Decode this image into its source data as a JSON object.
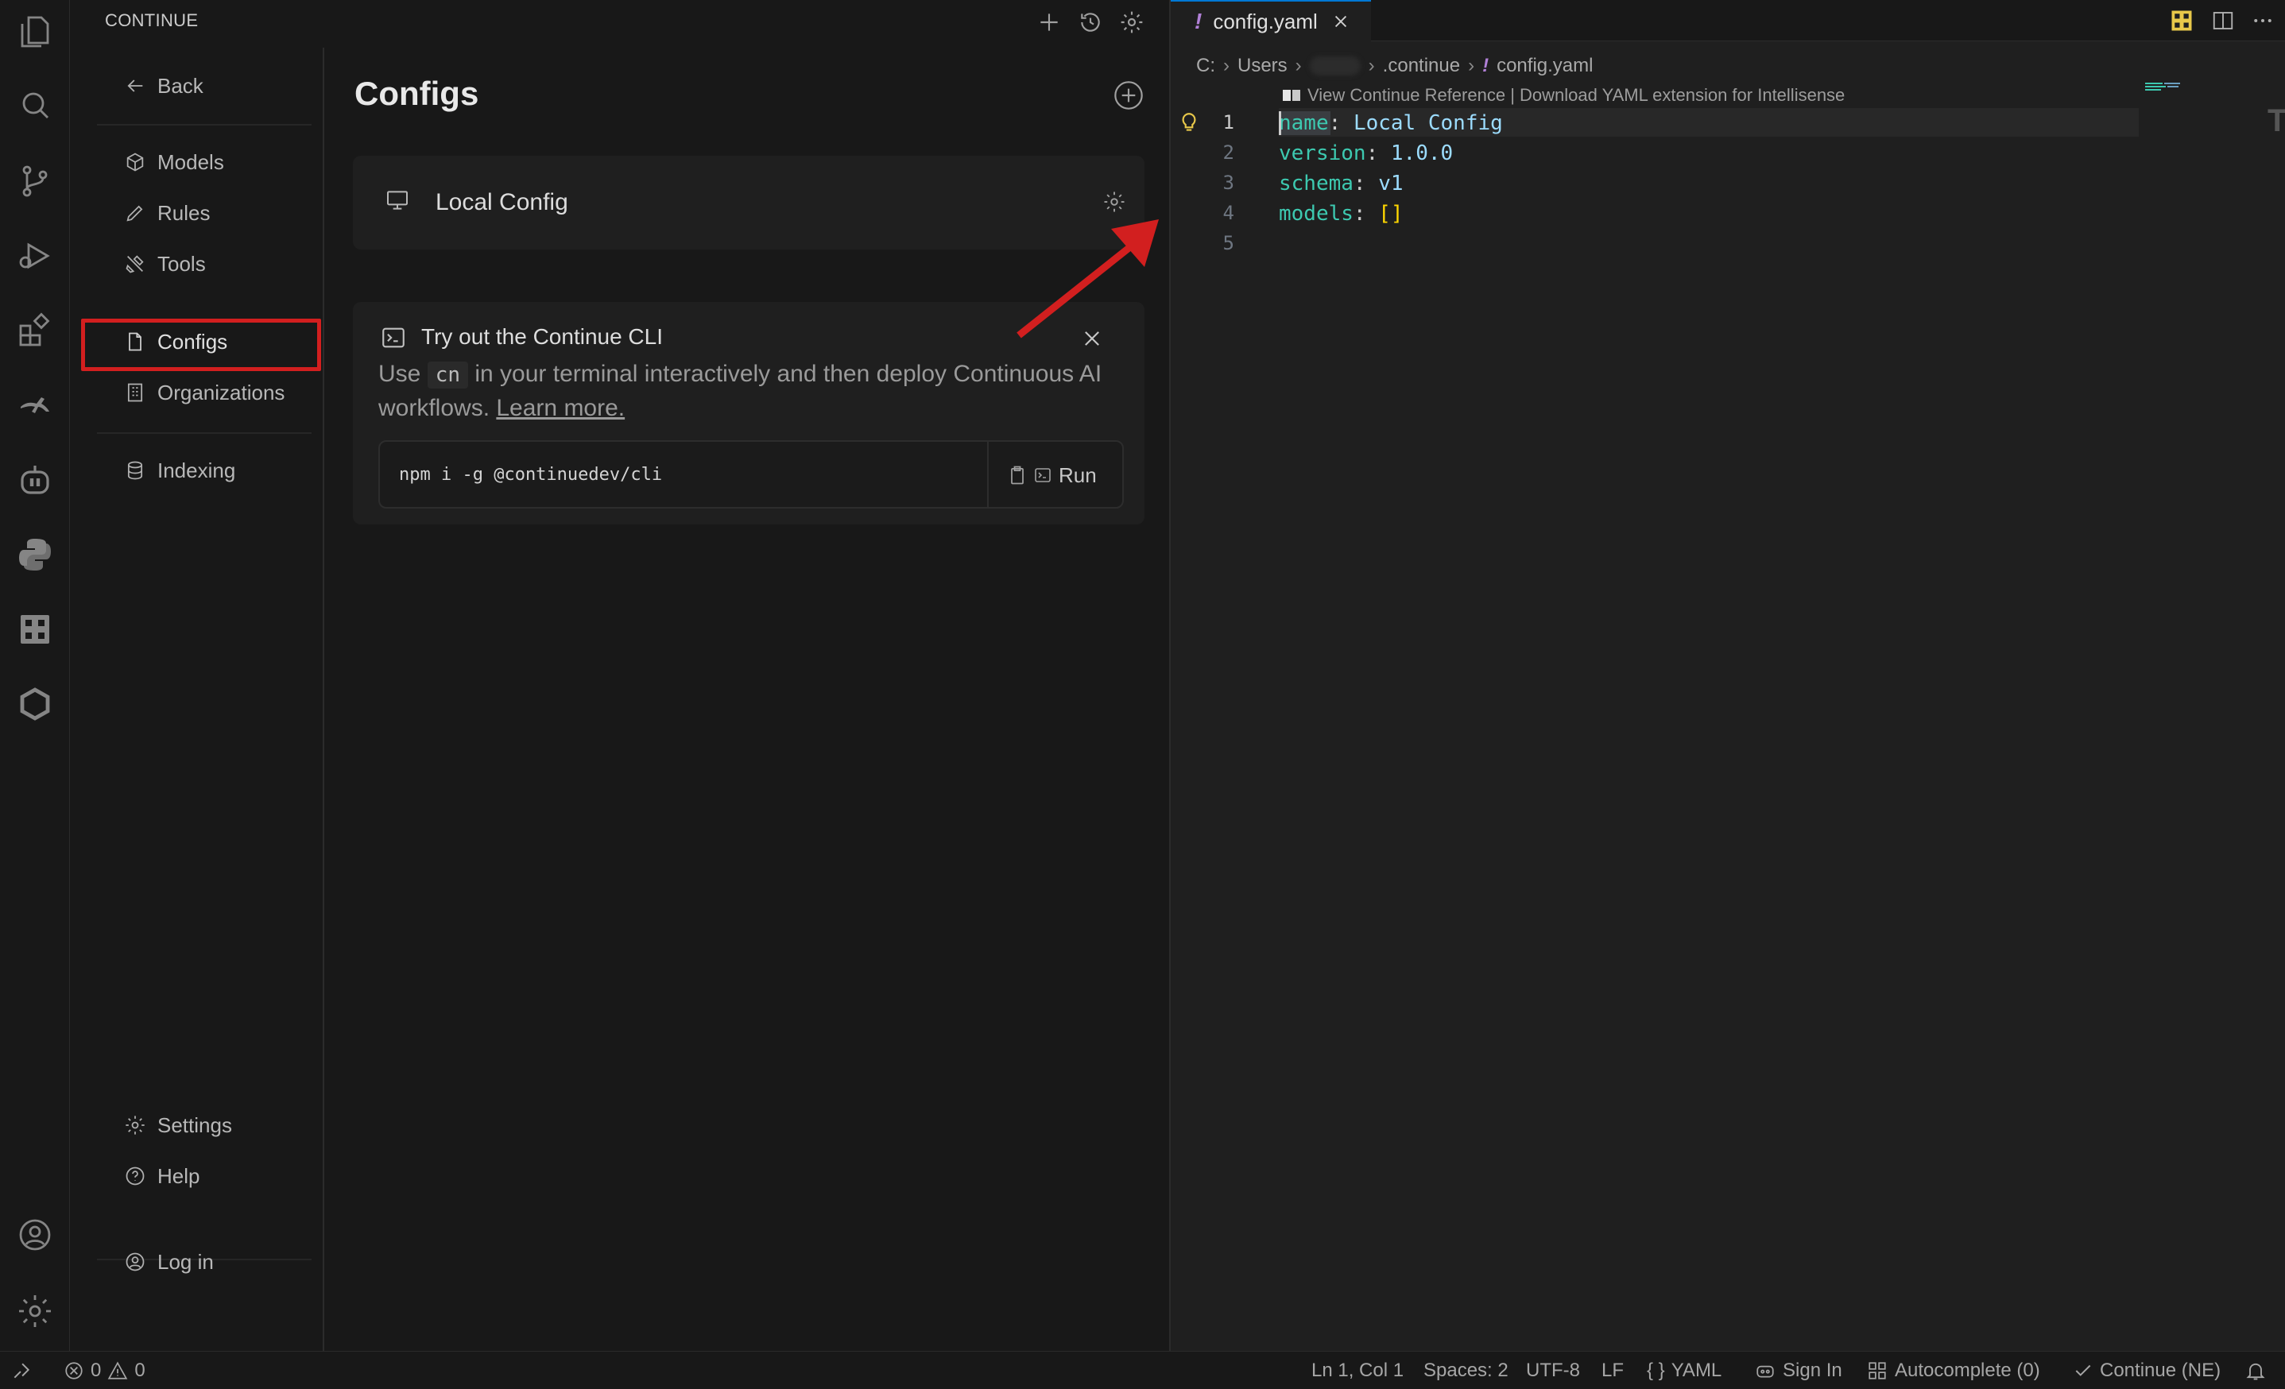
{
  "sidebar": {
    "title": "CONTINUE",
    "nav": {
      "back": "Back",
      "models": "Models",
      "rules": "Rules",
      "tools": "Tools",
      "configs": "Configs",
      "organizations": "Organizations",
      "indexing": "Indexing",
      "settings": "Settings",
      "help": "Help",
      "login": "Log in"
    }
  },
  "configs_page": {
    "title": "Configs",
    "local_config_name": "Local Config",
    "cli": {
      "title": "Try out the Continue CLI",
      "desc_prefix": "Use",
      "desc_code": "cn",
      "desc_suffix": "in your terminal interactively and then deploy Continuous AI workflows.",
      "learn_more": "Learn more.",
      "command": "npm i -g @continuedev/cli",
      "run_label": "Run"
    }
  },
  "editor": {
    "tab_label": "config.yaml",
    "breadcrumb": {
      "drive": "C:",
      "users": "Users",
      "folder": ".continue",
      "file": "config.yaml"
    },
    "codelens": "View Continue Reference | Download YAML extension for Intellisense",
    "line_numbers": [
      "1",
      "2",
      "3",
      "4",
      "5"
    ],
    "code": {
      "l1_key": "name",
      "l1_val": "Local Config",
      "l2_key": "version",
      "l2_val": "1.0.0",
      "l3_key": "schema",
      "l3_val": "v1",
      "l4_key": "models",
      "l4_val": "[]"
    }
  },
  "status_bar": {
    "errors": "0",
    "warnings": "0",
    "position": "Ln 1, Col 1",
    "spaces": "Spaces: 2",
    "encoding": "UTF-8",
    "eol": "LF",
    "language": "YAML",
    "sign_in": "Sign In",
    "autocomplete": "Autocomplete (0)",
    "continue": "Continue (NE)"
  },
  "colors": {
    "highlight_red": "#d21f1f",
    "yaml_icon": "#b180d7",
    "yaml_key": "#3dc9b0"
  }
}
